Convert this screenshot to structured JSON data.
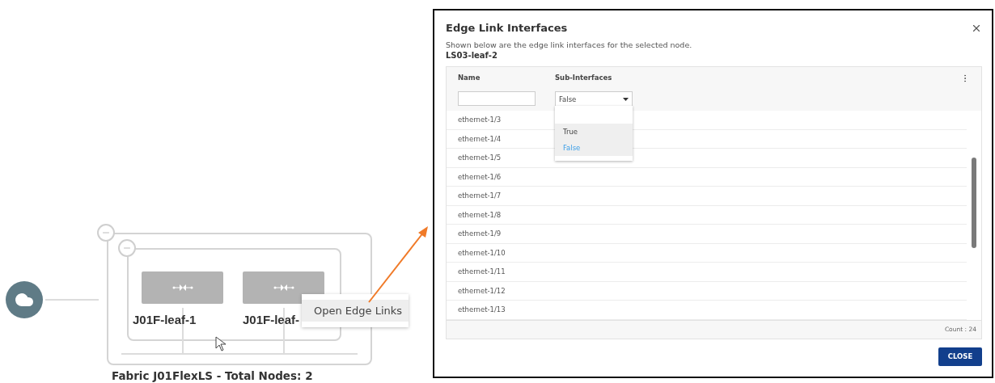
{
  "diagram": {
    "nodes": [
      {
        "label": "J01F-leaf-1"
      },
      {
        "label": "J01F-leaf-"
      }
    ],
    "caption": "Fabric J01FlexLS - Total Nodes: 2",
    "context_menu": {
      "items": [
        {
          "label": "Open Edge Links",
          "selected": true
        }
      ]
    }
  },
  "dialog": {
    "title": "Edge Link Interfaces",
    "description": "Shown below are the edge link interfaces for the selected node.",
    "node_name": "LS03-leaf-2",
    "table": {
      "columns": [
        "Name",
        "Sub-Interfaces"
      ],
      "sub_interfaces_filter": {
        "value": "False",
        "expanded": true,
        "options": [
          {
            "label": "True",
            "selected": false
          },
          {
            "label": "False",
            "selected": true
          }
        ]
      },
      "rows": [
        "ethernet-1/3",
        "ethernet-1/4",
        "ethernet-1/5",
        "ethernet-1/6",
        "ethernet-1/7",
        "ethernet-1/8",
        "ethernet-1/9",
        "ethernet-1/10",
        "ethernet-1/11",
        "ethernet-1/12",
        "ethernet-1/13"
      ],
      "footer": "Count : 24"
    },
    "buttons": [
      "CLOSE"
    ]
  }
}
